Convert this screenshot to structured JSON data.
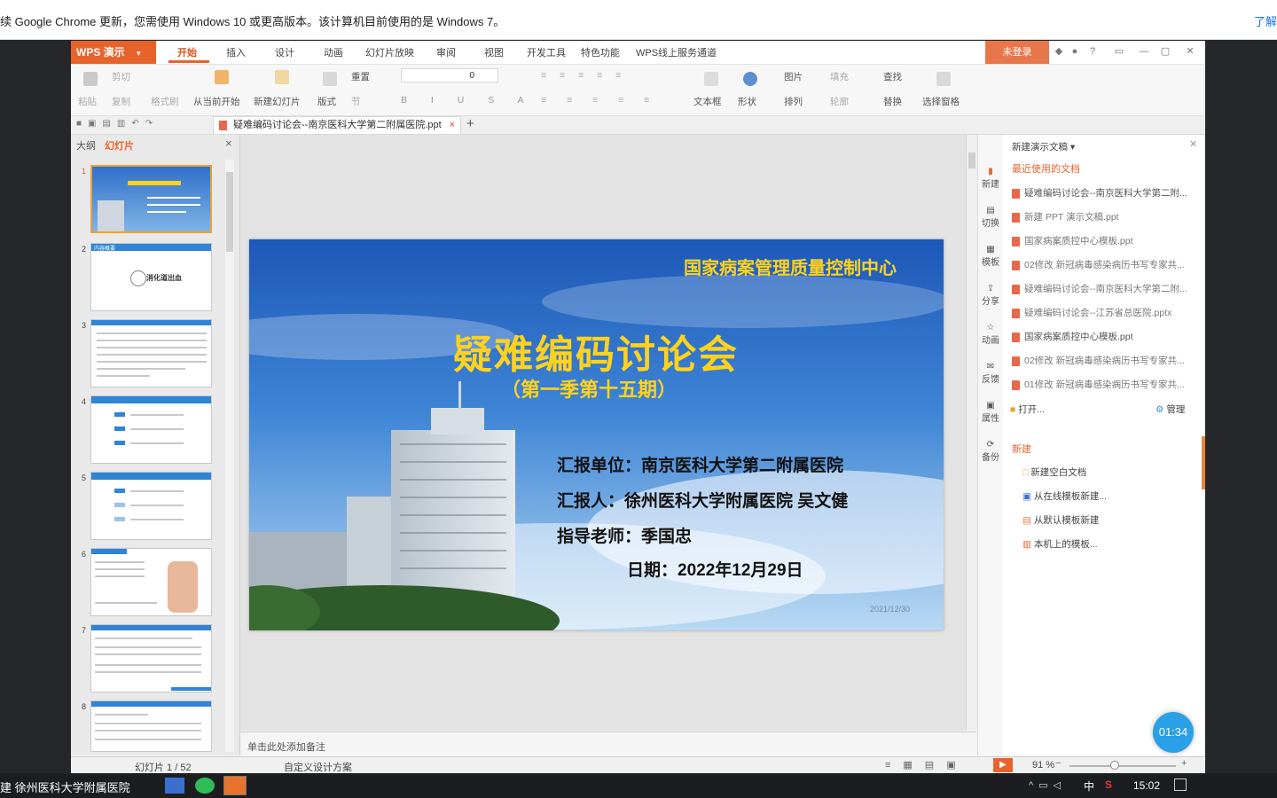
{
  "chrome": {
    "message": "续 Google Chrome 更新，您需使用 Windows 10 或更高版本。该计算机目前使用的是 Windows 7。",
    "link": "了解"
  },
  "wps": {
    "logo": "WPS 演示",
    "tabs": [
      "开始",
      "插入",
      "设计",
      "动画",
      "幻灯片放映",
      "审阅",
      "视图",
      "开发工具",
      "特色功能",
      "WPS线上服务通道"
    ],
    "login": "未登录",
    "ribbon": {
      "paste": "粘贴",
      "cut": "剪切",
      "copy": "复制",
      "format_painter": "格式刷",
      "from_current": "从当前开始",
      "new_slide": "新建幻灯片",
      "layout": "版式",
      "reset": "重置",
      "section": "节",
      "font_size": "0",
      "textbox": "文本框",
      "shape": "形状",
      "arrange": "排列",
      "picture": "图片",
      "fill": "填充",
      "outline": "轮廓",
      "find": "查找",
      "replace": "替换",
      "select_pane": "选择窗格"
    },
    "doc_tab": "疑难编码讨论会--南京医科大学第二附属医院.ppt",
    "left_tabs": [
      "大纲",
      "幻灯片"
    ],
    "thumb_numbers": [
      "1",
      "2",
      "3",
      "4",
      "5",
      "6",
      "7",
      "8"
    ],
    "thumb2_text": "消化道出血",
    "thumb2_header": "内容概要",
    "notes_placeholder": "单击此处添加备注",
    "status": {
      "slide_counter": "幻灯片 1 / 52",
      "theme": "自定义设计方案",
      "zoom": "91 %"
    }
  },
  "slide": {
    "org": "国家病案管理质量控制中心",
    "title": "疑难编码讨论会",
    "subtitle": "（第一季第十五期）",
    "unit": "汇报单位：南京医科大学第二附属医院",
    "presenter": "汇报人：徐州医科大学附属医院  吴文健",
    "advisor": "指导老师：季国忠",
    "date": "日期：2022年12月29日",
    "footer_date": "2021/12/30"
  },
  "right_panel": {
    "header": "新建演示文稿",
    "side_icons": [
      "新建",
      "切换",
      "模板",
      "分享",
      "动画",
      "反馈",
      "属性",
      "备份"
    ],
    "recent_title": "最近使用的文档",
    "recent": [
      "疑难编码讨论会--南京医科大学第二附...",
      "新建 PPT 演示文稿.ppt",
      "国家病案质控中心模板.ppt",
      "02修改 新冠病毒感染病历书写专家共...",
      "疑难编码讨论会--南京医科大学第二附...",
      "疑难编码讨论会--江苏省总医院.pptx",
      "国家病案质控中心模板.ppt",
      "02修改 新冠病毒感染病历书写专家共...",
      "01修改 新冠病毒感染病历书写专家共..."
    ],
    "open": "打开...",
    "manage": "管理",
    "new_title": "新建",
    "new_items": [
      "新建空白文档",
      "从在线模板新建...",
      "从默认模板新建",
      "本机上的模板..."
    ]
  },
  "timer": "01:34",
  "taskbar": {
    "window_title": "建 徐州医科大学附属医院",
    "ime": "中",
    "clock": "15:02"
  },
  "colors": {
    "wps_orange": "#e8632b",
    "slide_title_yellow": "#ffd21e",
    "timer_blue": "#2aa0e8"
  }
}
